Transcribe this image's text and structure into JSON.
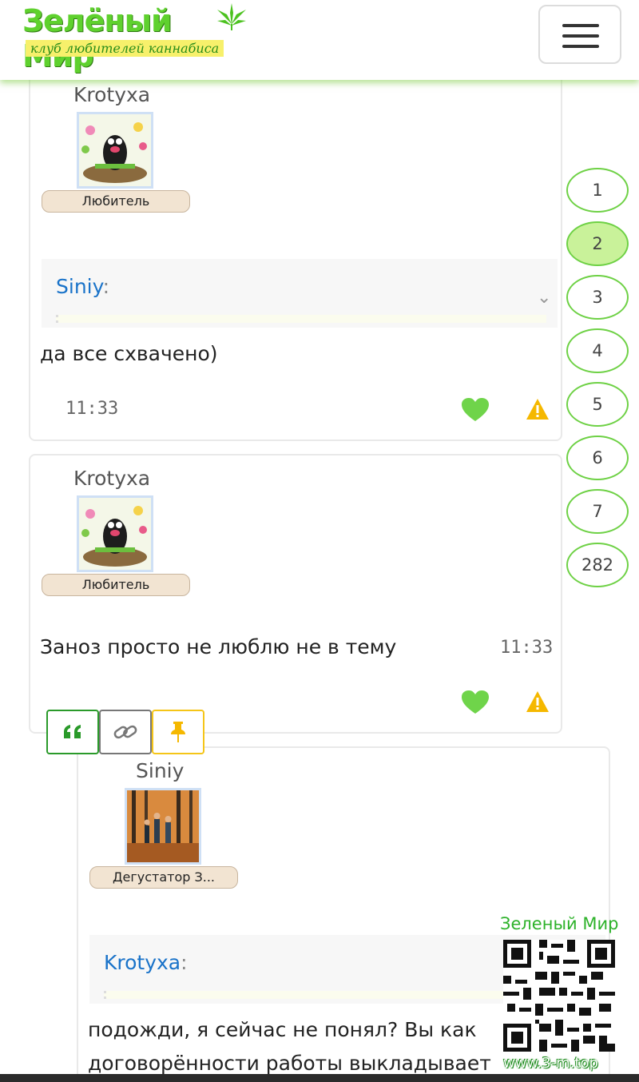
{
  "header": {
    "logo_title": "Зелёный Мир",
    "logo_subtitle": "клуб любителей каннабиса",
    "menu_icon": "hamburger-icon"
  },
  "posts": [
    {
      "author": "Krotyxa",
      "rank": "Любитель",
      "quote_author": "Siniy",
      "quote_colon": ":",
      "message": "да все схвачено)",
      "time": "11:33"
    },
    {
      "author": "Krotyxa",
      "rank": "Любитель",
      "message": "Заноз просто не люблю не в тему",
      "time": "11:33"
    },
    {
      "author": "Siniy",
      "rank": "Дегустатор З...",
      "quote_author": "Krotyxa",
      "quote_colon": ":",
      "message_line1": "подожди, я сейчас не понял? Вы как",
      "message_line2": "договорённости работы выкладывает"
    }
  ],
  "actions": {
    "quote_icon": "quote-icon",
    "link_icon": "link-icon",
    "pin_icon": "pin-icon"
  },
  "pagination": {
    "pages": [
      "1",
      "2",
      "3",
      "4",
      "5",
      "6",
      "7",
      "282"
    ],
    "active": "2"
  },
  "watermark": {
    "title": "Зеленый Мир",
    "url": "www.3-m.top"
  },
  "colors": {
    "brand_green": "#5fd12e",
    "link_blue": "#1a73c9",
    "active_page": "#c9f29a",
    "warning": "#f5b800"
  }
}
